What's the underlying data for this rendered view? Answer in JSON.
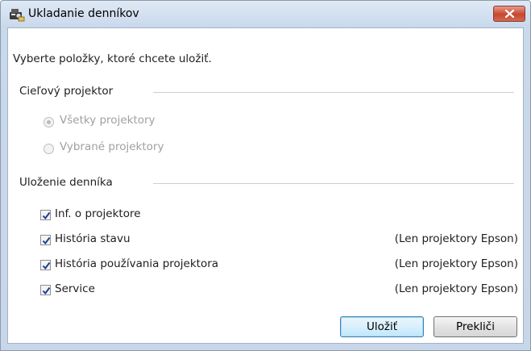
{
  "window": {
    "title": "Ukladanie denníkov",
    "instruction": "Vyberte položky, ktoré chcete uložiť."
  },
  "target_group": {
    "label": "Cieľový projektor",
    "options": [
      {
        "label": "Všetky projektory",
        "selected": true,
        "enabled": false
      },
      {
        "label": "Vybrané projektory",
        "selected": false,
        "enabled": false
      }
    ]
  },
  "save_group": {
    "label": "Uloženie denníka",
    "items": [
      {
        "label": "Inf. o projektore",
        "checked": true,
        "note": ""
      },
      {
        "label": "História stavu",
        "checked": true,
        "note": "(Len projektory Epson)"
      },
      {
        "label": "História používania projektora",
        "checked": true,
        "note": "(Len projektory Epson)"
      },
      {
        "label": "Service",
        "checked": true,
        "note": "(Len projektory Epson)"
      }
    ]
  },
  "buttons": {
    "save": "Uložiť",
    "cancel": "Prekliči"
  },
  "icons": {
    "title": "projector-app-icon",
    "close": "close-icon",
    "check": "checkmark-icon"
  },
  "colors": {
    "check_mark": "#1c3f95",
    "close_button": "#c7472e"
  }
}
